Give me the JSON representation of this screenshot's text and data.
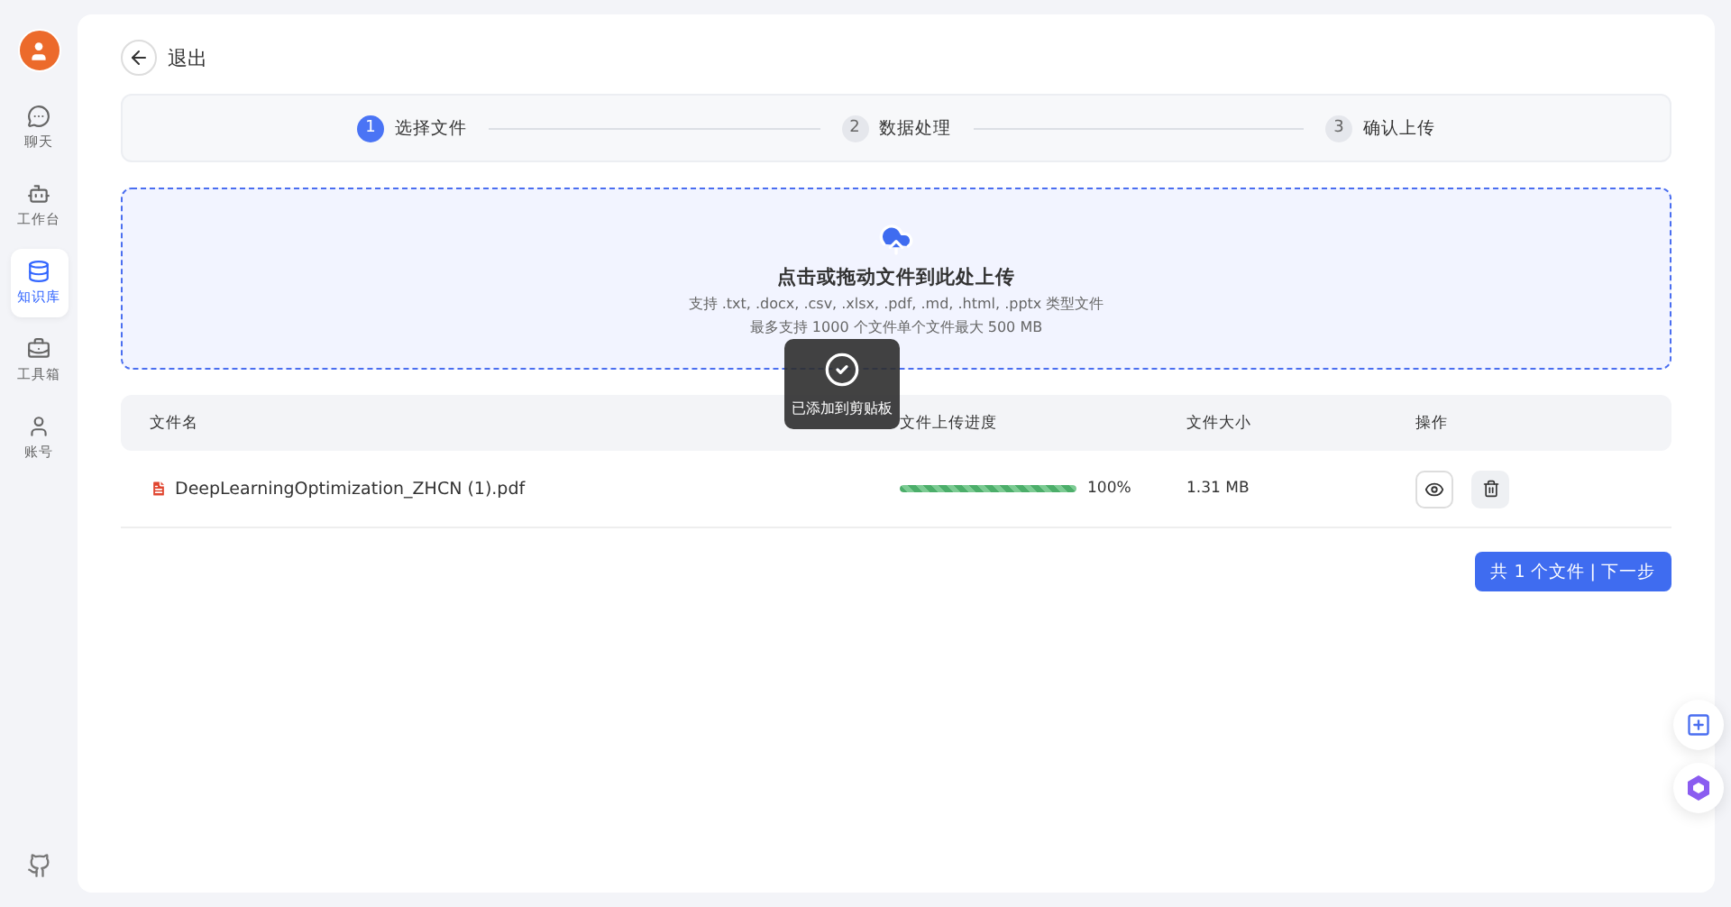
{
  "sidebar": {
    "items": [
      {
        "label": "聊天",
        "selected": false
      },
      {
        "label": "工作台",
        "selected": false
      },
      {
        "label": "知识库",
        "selected": true
      },
      {
        "label": "工具箱",
        "selected": false
      },
      {
        "label": "账号",
        "selected": false
      }
    ]
  },
  "back": {
    "label": "退出"
  },
  "steps": [
    {
      "number": "1",
      "label": "选择文件",
      "selected": true
    },
    {
      "number": "2",
      "label": "数据处理",
      "selected": false
    },
    {
      "number": "3",
      "label": "确认上传",
      "selected": false
    }
  ],
  "upload": {
    "title": "点击或拖动文件到此处上传",
    "hint": "支持 .txt, .docx, .csv, .xlsx, .pdf, .md, .html, .pptx 类型文件",
    "limit": "最多支持 1000 个文件单个文件最大 500 MB"
  },
  "table": {
    "columns": [
      "文件名",
      "文件上传进度",
      "文件大小",
      "操作"
    ],
    "rows": [
      {
        "name": "DeepLearningOptimization_ZHCN (1).pdf",
        "level": 1,
        "progress": "100%",
        "size": "1.31 MB"
      }
    ]
  },
  "next_button": "共 1 个文件 | 下一步",
  "toast": {
    "message": "已添加到剪贴板"
  }
}
